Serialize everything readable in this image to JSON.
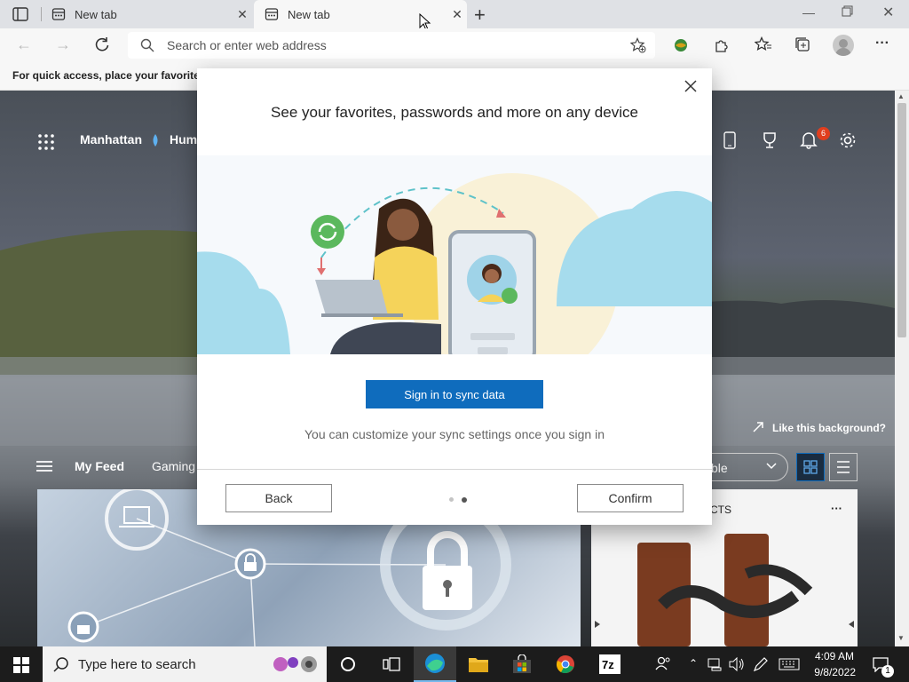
{
  "browser": {
    "tabs": [
      {
        "label": "New tab",
        "active": false
      },
      {
        "label": "New tab",
        "active": true
      }
    ],
    "new_tab_symbol": "+",
    "address_placeholder": "Search or enter web address",
    "favorites_bar_text": "For quick access, place your favorites h"
  },
  "ntp": {
    "location": "Manhattan",
    "weather_text": "Hum",
    "notification_count": "6",
    "like_background": "Like this background?",
    "feed_tabs": [
      "My Feed",
      "Gaming"
    ],
    "layout_select": "ble",
    "card_label": "CTS",
    "more_dots": "···"
  },
  "dialog": {
    "title": "See your favorites, passwords and more on any device",
    "primary_button": "Sign in to sync data",
    "note": "You can customize your sync settings once you sign in",
    "back_button": "Back",
    "confirm_button": "Confirm",
    "pager_total": 2,
    "pager_active": 2
  },
  "taskbar": {
    "search_placeholder": "Type here to search",
    "time": "4:09 AM",
    "date": "9/8/2022",
    "notification_badge": "1"
  },
  "colors": {
    "accent": "#0f6cbd",
    "badge": "#e03e1e"
  }
}
